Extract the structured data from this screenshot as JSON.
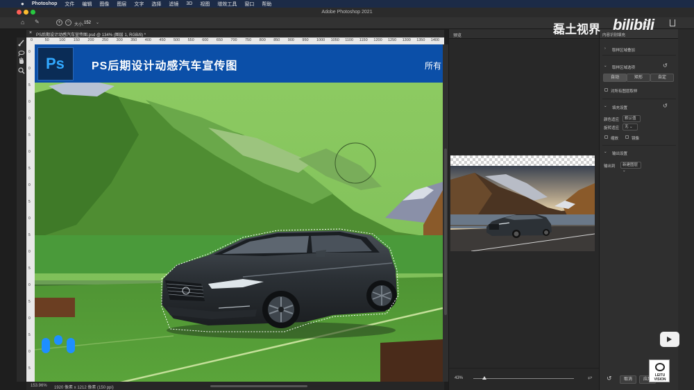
{
  "menubar": {
    "items": [
      "Photoshop",
      "文件",
      "编辑",
      "图像",
      "图层",
      "文字",
      "选择",
      "滤镜",
      "3D",
      "视图",
      "增效工具",
      "窗口",
      "帮助"
    ]
  },
  "window": {
    "title": "Adobe Photoshop 2021"
  },
  "options": {
    "size_label": "大小:",
    "size_value": "152"
  },
  "document": {
    "tab_title": "PS后期设计动感汽车宣传图.psd @ 134% (图层 1, RGB/8) *",
    "zoom": "153.96%",
    "dimensions": "1920 像素 x 1212 像素 (150 ppi)"
  },
  "ruler": {
    "h_ticks": [
      "0",
      "50",
      "100",
      "150",
      "200",
      "250",
      "300",
      "350",
      "400",
      "450",
      "500",
      "550",
      "600",
      "650",
      "700",
      "750",
      "800",
      "850",
      "900",
      "950",
      "1000",
      "1050",
      "1100",
      "1150",
      "1200",
      "1250",
      "1300",
      "1350",
      "1400",
      "1450"
    ],
    "v_ticks": [
      "0",
      "0",
      "5",
      "0",
      "0",
      "5",
      "0",
      "5",
      "0",
      "5",
      "0",
      "5",
      "0",
      "5",
      "0",
      "5",
      "0",
      "5",
      "0",
      "5"
    ]
  },
  "banner": {
    "logo": "Ps",
    "title": "PS后期设计动感汽车宣传图",
    "right_text": "所有"
  },
  "preview": {
    "panel_title": "预览",
    "zoom": "43%"
  },
  "right_panel": {
    "title": "内容识别填充",
    "sampling_overlay": "取样区域叠加",
    "sampling_options": "取样区域选项",
    "mode_auto": "自动",
    "mode_rect": "矩形",
    "mode_custom": "自定",
    "sample_all_layers": "对所有图层取样",
    "fill_settings": "填充设置",
    "color_adapt_label": "颜色适应",
    "color_adapt_value": "默认值",
    "rotation_adapt_label": "旋转适应",
    "rotation_adapt_value": "无",
    "scale": "缩放",
    "mirror": "镜像",
    "output_settings": "输出设置",
    "output_to_label": "输出到",
    "output_to_value": "新建图层",
    "cancel": "取消",
    "apply": "应用"
  },
  "watermark": {
    "text": "磊土视界",
    "brand": "bilibili",
    "badge_text": "LEITU VISION"
  },
  "colors": {
    "accent_blue": "#0b4fa8",
    "overlay_green": "#5aa43a",
    "menubar": "#1c2b47"
  }
}
